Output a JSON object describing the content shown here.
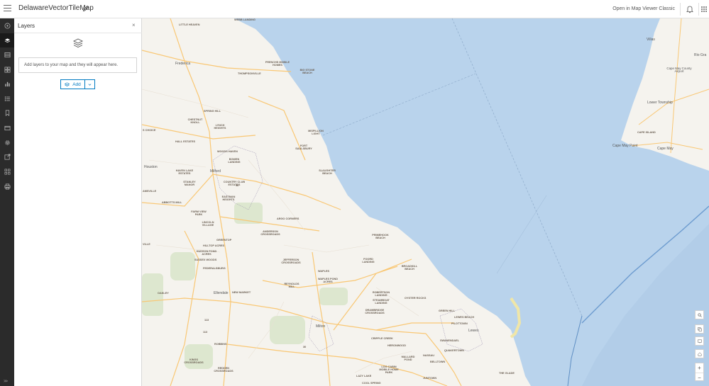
{
  "header": {
    "title": "DelawareVectorTileMap",
    "open_classic": "Open in Map Viewer Classic"
  },
  "panel": {
    "title": "Layers",
    "close": "×",
    "empty_message": "Add layers to your map and they will appear here.",
    "add_label": "Add"
  },
  "rail": {
    "collapse": ">>"
  },
  "map": {
    "places": [
      {
        "name": "WEBB LANDING",
        "id": "webb-landing"
      },
      {
        "name": "LITTLE HEAVEN",
        "id": "little-heaven"
      },
      {
        "name": "Frederica",
        "id": "frederica"
      },
      {
        "name": "FRENCHS MOBILE HOMES",
        "id": "frenchs-mobile-homes"
      },
      {
        "name": "THOMPSONVILLE",
        "id": "thompsonville"
      },
      {
        "name": "BIG STONE BEACH",
        "id": "big-stone-beach"
      },
      {
        "name": "SPRING HILL",
        "id": "spring-hill"
      },
      {
        "name": "CHESTNUT KNOLL",
        "id": "chestnut-knoll"
      },
      {
        "name": "LYNCH HEIGHTS",
        "id": "lynch-heights"
      },
      {
        "name": "S CHOICE",
        "id": "s-choice"
      },
      {
        "name": "MISPILLION LIGHT",
        "id": "mispillion-light"
      },
      {
        "name": "FORT SAULSBURY",
        "id": "fort-saulsbury"
      },
      {
        "name": "HALL ESTATES",
        "id": "hall-estates"
      },
      {
        "name": "WOODS HAVEN",
        "id": "woods-haven"
      },
      {
        "name": "BOWEN LANDING",
        "id": "bowen-landing"
      },
      {
        "name": "Houston",
        "id": "houston"
      },
      {
        "name": "HAVEN LAKE ESTATES",
        "id": "haven-lake-estates"
      },
      {
        "name": "Milford",
        "id": "milford"
      },
      {
        "name": "SLAUGHTER BEACH",
        "id": "slaughter-beach"
      },
      {
        "name": "STANLEY MANOR",
        "id": "stanley-manor"
      },
      {
        "name": "COUNTRY CLUB ESTATES",
        "id": "country-club-estates"
      },
      {
        "name": "AMSVILLE",
        "id": "amsville"
      },
      {
        "name": "EASTMAN HEIGHTS",
        "id": "eastman-heights"
      },
      {
        "name": "ABBOTTS MILL",
        "id": "abbotts-mill"
      },
      {
        "name": "FARM VIEW PARK",
        "id": "farm-view-park"
      },
      {
        "name": "ARGO CORNERS",
        "id": "argo-corners"
      },
      {
        "name": "LINCOLN VILLAGE",
        "id": "lincoln-village"
      },
      {
        "name": "ANDERSON CROSSROADS",
        "id": "anderson-crossroads"
      },
      {
        "name": "PRIMEHOOK BEACH",
        "id": "primehook-beach"
      },
      {
        "name": "GREENTOP",
        "id": "greentop"
      },
      {
        "name": "HILLTOP ACRES",
        "id": "hilltop-acres"
      },
      {
        "name": "VILLE",
        "id": "ville"
      },
      {
        "name": "HUDSON POND ACRES",
        "id": "hudson-pond-acres"
      },
      {
        "name": "SUSSEX WOODS",
        "id": "sussex-woods"
      },
      {
        "name": "JEFFERSON CROSSROADS",
        "id": "jefferson-crossroads"
      },
      {
        "name": "FOORD LANDING",
        "id": "foord-landing"
      },
      {
        "name": "BROADKILL BEACH",
        "id": "broadkill-beach"
      },
      {
        "name": "FEDERALSBURG",
        "id": "federalsburg"
      },
      {
        "name": "WAPLES",
        "id": "waples"
      },
      {
        "name": "WAPLES POND ACRES",
        "id": "waples-pond-acres"
      },
      {
        "name": "REYNOLDS MILL",
        "id": "reynolds-mill"
      },
      {
        "name": "OAKLEY",
        "id": "oakley"
      },
      {
        "name": "Ellendale",
        "id": "ellendale"
      },
      {
        "name": "NEW MARKET",
        "id": "new-market"
      },
      {
        "name": "ROBERTSON LANDING",
        "id": "robertson-landing"
      },
      {
        "name": "STEAMBOAT LANDING",
        "id": "steamboat-landing"
      },
      {
        "name": "OYSTER ROCKS",
        "id": "oyster-rocks"
      },
      {
        "name": "DRAWBRIDGE CROSSROADS",
        "id": "drawbridge-crossroads"
      },
      {
        "name": "GREEN HILL",
        "id": "green-hill"
      },
      {
        "name": "LEWES BEACH",
        "id": "lewes-beach"
      },
      {
        "name": "PILOTTOWN",
        "id": "pilottown"
      },
      {
        "name": "Milton",
        "id": "milton"
      },
      {
        "name": "Lewes",
        "id": "lewes"
      },
      {
        "name": "CRIPPLE CREEK",
        "id": "cripple-creek"
      },
      {
        "name": "SWANENDAEL",
        "id": "swanendael"
      },
      {
        "name": "ROBBINS",
        "id": "robbins"
      },
      {
        "name": "HERONWOOD",
        "id": "heronwood"
      },
      {
        "name": "QUAKERTOWN",
        "id": "quakertown"
      },
      {
        "name": "NASSAU",
        "id": "nassau"
      },
      {
        "name": "MALLARD POND",
        "id": "mallard-pond"
      },
      {
        "name": "BELLTOWN",
        "id": "belltown"
      },
      {
        "name": "KINGS CROSSROADS",
        "id": "kings-crossroads"
      },
      {
        "name": "LOG CABIN MOBILE HOME PARK",
        "id": "log-cabin"
      },
      {
        "name": "REDDEN CROSSROADS",
        "id": "redden-crossroads"
      },
      {
        "name": "LAZY LAKE",
        "id": "lazy-lake"
      },
      {
        "name": "JUNTOWN",
        "id": "juntown"
      },
      {
        "name": "THE GLADE",
        "id": "the-glade"
      },
      {
        "name": "COOL SPRING",
        "id": "cool-spring"
      },
      {
        "name": "Villas",
        "id": "villas"
      },
      {
        "name": "Cape May County Airport",
        "id": "cape-may-airport"
      },
      {
        "name": "Lower Township",
        "id": "lower-township"
      },
      {
        "name": "CAPE ISLAND",
        "id": "cape-island"
      },
      {
        "name": "Cape May Point",
        "id": "cape-may-point"
      },
      {
        "name": "Cape May",
        "id": "cape-may"
      },
      {
        "name": "Rio Gra",
        "id": "rio-gra"
      },
      {
        "name": "113",
        "id": "route-113a"
      },
      {
        "name": "113",
        "id": "route-113b"
      },
      {
        "name": "30",
        "id": "route-30"
      },
      {
        "name": "16",
        "id": "route-16"
      }
    ]
  },
  "icons": {
    "menu": "hamburger-icon",
    "edit": "pencil-icon",
    "bell": "bell-icon",
    "apps": "apps-grid-icon"
  }
}
